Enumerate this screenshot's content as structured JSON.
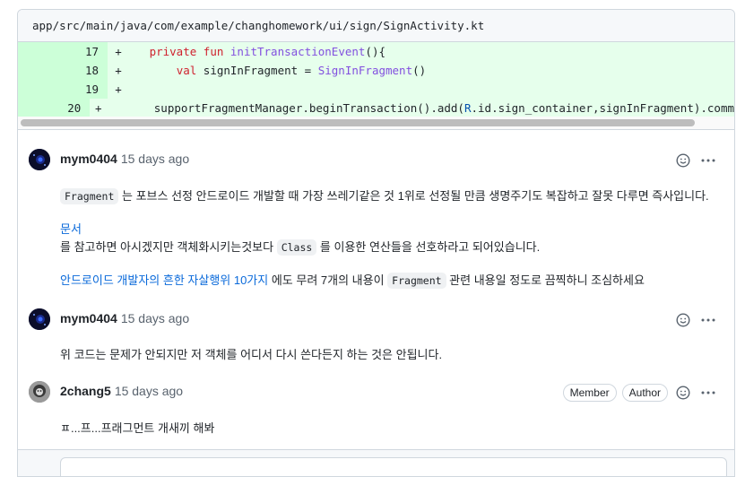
{
  "file": {
    "path": "app/src/main/java/com/example/changhomework/ui/sign/SignActivity.kt"
  },
  "diff": {
    "lines": [
      {
        "num": "17",
        "sign": "+"
      },
      {
        "num": "18",
        "sign": "+"
      },
      {
        "num": "19",
        "sign": "+"
      },
      {
        "num": "20",
        "sign": "+"
      }
    ],
    "code": {
      "l17_kw1": "private",
      "l17_kw2": "fun",
      "l17_fn": "initTransactionEvent",
      "l17_rest": "(){",
      "l18_kw": "val",
      "l18_name": "signInFragment",
      "l18_eq": " = ",
      "l18_ty": "SignInFragment",
      "l18_rest": "()",
      "l20_a": "supportFragmentManager.beginTransaction().add(",
      "l20_r": "R",
      "l20_b": ".id.sign_container,signInFragment).comm"
    }
  },
  "comments": [
    {
      "author": "mym0404",
      "time": "15 days ago",
      "p1_code": "Fragment",
      "p1_text": " 는 포브스 선정 안드로이드 개발할 때 가장 쓰레기같은 것 1위로 선정될 만큼 생명주기도 복잡하고 잘못 다루면 즉사입니다.",
      "p2_link": "문서",
      "p2_text_a": "를 참고하면 아시겠지만 객체화시키는것보다 ",
      "p2_code": "Class",
      "p2_text_b": " 를 이용한 연산들을 선호하라고 되어있습니다.",
      "p3_link": "안드로이드 개발자의 흔한 자살행위 10가지",
      "p3_text_a": " 에도 무려 7개의 내용이 ",
      "p3_code": "Fragment",
      "p3_text_b": " 관련 내용일 정도로 끔찍하니 조심하세요"
    },
    {
      "author": "mym0404",
      "time": "15 days ago",
      "text": "위 코드는 문제가 안되지만 저 객체를 어디서 다시 쓴다든지 하는 것은 안됩니다."
    },
    {
      "author": "2chang5",
      "time": "15 days ago",
      "badge_member": "Member",
      "badge_author": "Author",
      "text": "ㅍ...프...프래그먼트 개새끼 해봐"
    }
  ],
  "icons": {
    "emoji": "smiley-icon",
    "more": "kebab-icon"
  },
  "colors": {
    "added_bg": "#e6ffec",
    "added_num_bg": "#ccffd8",
    "link": "#0969da"
  }
}
